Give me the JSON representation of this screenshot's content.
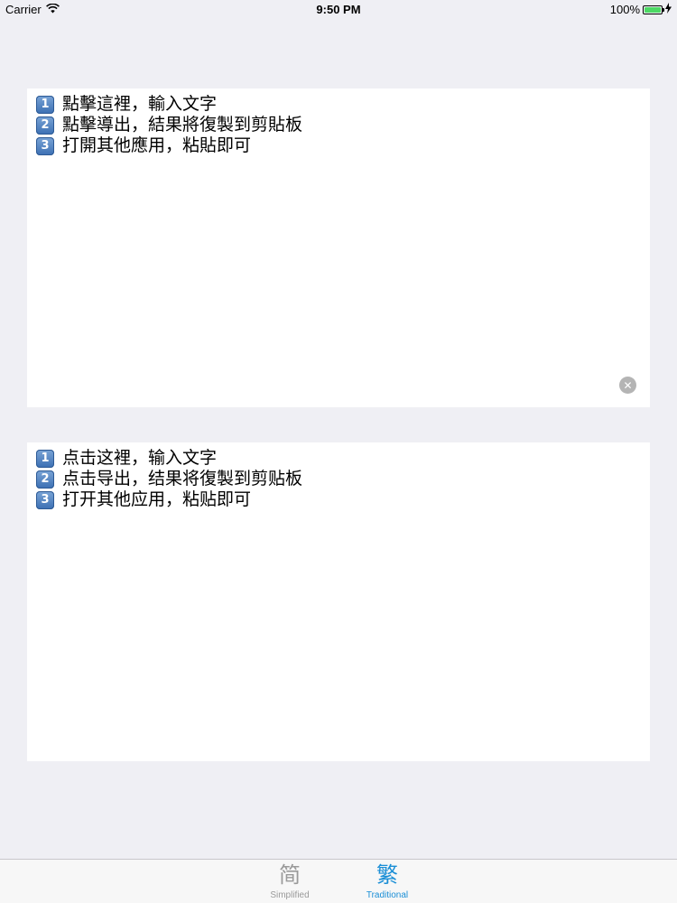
{
  "status_bar": {
    "carrier": "Carrier",
    "time": "9:50 PM",
    "battery_percent": "100%",
    "battery_level": 1.0,
    "icons": [
      "wifi-icon",
      "battery-icon",
      "charging-bolt-icon"
    ]
  },
  "traditional_panel": {
    "lines": [
      {
        "badge": "1",
        "text": "點擊這裡，輸入文字"
      },
      {
        "badge": "2",
        "text": "點擊導出，結果將復製到剪貼板"
      },
      {
        "badge": "3",
        "text": "打開其他應用，粘貼即可"
      }
    ],
    "clear_icon": "clear-icon"
  },
  "simplified_panel": {
    "lines": [
      {
        "badge": "1",
        "text": "点击这裡，输入文字"
      },
      {
        "badge": "2",
        "text": "点击导出，结果将復製到剪贴板"
      },
      {
        "badge": "3",
        "text": "打开其他应用，粘贴即可"
      }
    ]
  },
  "tab_bar": {
    "tabs": [
      {
        "icon": "简",
        "label": "Simplified",
        "selected": false
      },
      {
        "icon": "繁",
        "label": "Traditional",
        "selected": true
      }
    ],
    "selected_color": "#1a8ed6",
    "unselected_color": "#9a9a9a"
  }
}
